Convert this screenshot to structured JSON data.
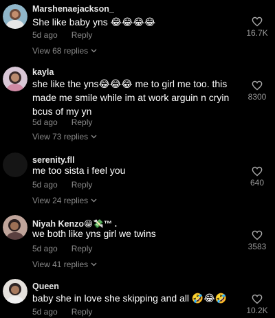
{
  "comments": [
    {
      "username": "Marshenaejackson_",
      "text": "She like baby yns 😂😂😂😂",
      "time": "5d ago",
      "reply_label": "Reply",
      "view_replies": "View 68 replies",
      "likes": "16.7K"
    },
    {
      "username": "kayla",
      "text": "she like the yns😂😂😂 me to girl me too. this made me smile while im at work arguin n cryin bcus of my yn",
      "time": "5d ago",
      "reply_label": "Reply",
      "view_replies": "View 73 replies",
      "likes": "8300"
    },
    {
      "username": "serenity.fll",
      "text": "me too sista i feel you",
      "time": "5d ago",
      "reply_label": "Reply",
      "view_replies": "View 24 replies",
      "likes": "640"
    },
    {
      "username": "Niyah Kenzo😁💸™ .",
      "text": "we both like yns girl we twins",
      "time": "5d ago",
      "reply_label": "Reply",
      "view_replies": "View 41 replies",
      "likes": "3583"
    },
    {
      "username": "Queen",
      "text": "baby she in love she skipping and all 🤣😂🤣",
      "time": "5d ago",
      "reply_label": "Reply",
      "view_replies": "",
      "likes": "10.2K"
    }
  ],
  "icons": {
    "like": "heart-outline-icon",
    "expand": "chevron-down-icon"
  },
  "colors": {
    "background": "#000000",
    "secondary_text": "#8a8a8a"
  }
}
